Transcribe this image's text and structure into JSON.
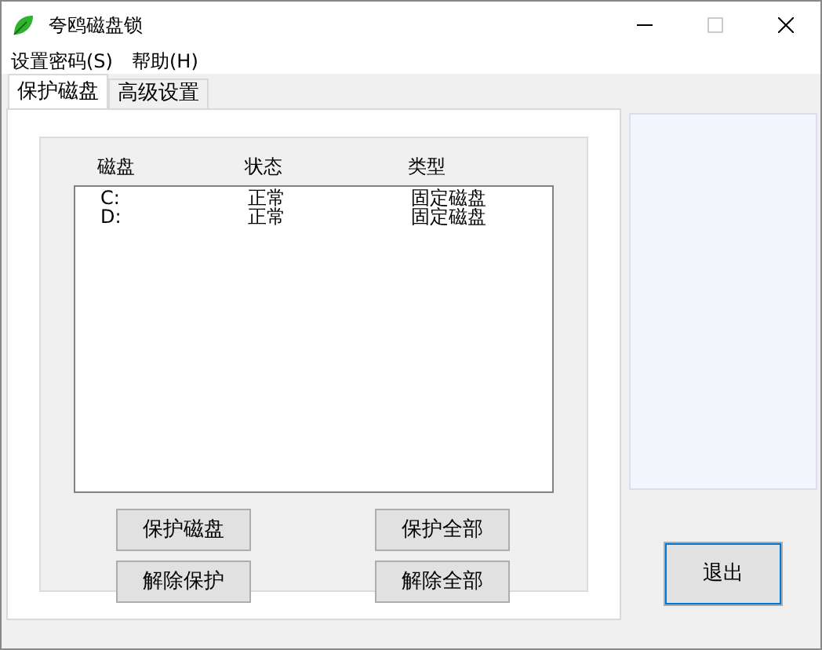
{
  "window": {
    "title": "夸鸥磁盘锁"
  },
  "menu": [
    "设置密码(S)",
    "帮助(H)"
  ],
  "tabs": [
    {
      "label": "保护磁盘",
      "selected": true
    },
    {
      "label": "高级设置",
      "selected": false
    }
  ],
  "disk_list": {
    "columns": [
      "磁盘",
      "状态",
      "类型"
    ],
    "rows": [
      [
        "C:",
        "正常",
        "固定磁盘"
      ],
      [
        "D:",
        "正常",
        "固定磁盘"
      ]
    ]
  },
  "buttons": [
    [
      "保护磁盘",
      "保护全部"
    ],
    [
      "解除保护",
      "解除全部"
    ]
  ],
  "exit_button": "退出"
}
